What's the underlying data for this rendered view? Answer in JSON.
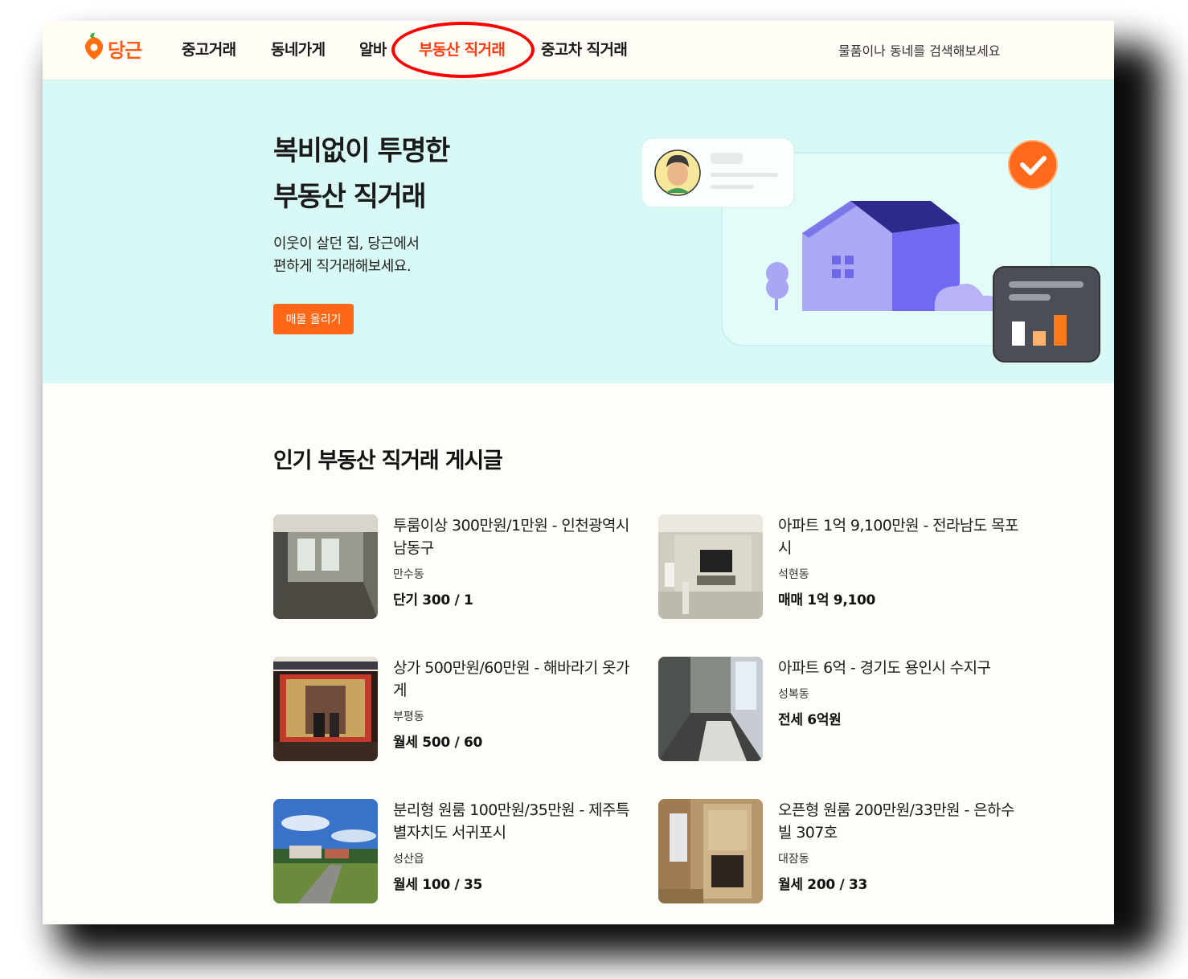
{
  "header": {
    "logo_text": "당근",
    "nav": [
      "중고거래",
      "동네가게",
      "알바",
      "부동산 직거래",
      "중고차 직거래"
    ],
    "active_index": 3,
    "search_placeholder": "물품이나 동네를 검색해보세요"
  },
  "hero": {
    "title_line1": "복비없이 투명한",
    "title_line2": "부동산 직거래",
    "desc_line1": "이웃이 살던 집, 당근에서",
    "desc_line2": "편하게 직거래해보세요.",
    "button_label": "매물 올리기"
  },
  "listings_section": {
    "title": "인기 부동산 직거래 게시글",
    "items": [
      {
        "title": "투룸이상 300만원/1만원 - 인천광역시 남동구",
        "location": "만수동",
        "price": "단기 300 / 1"
      },
      {
        "title": "아파트 1억 9,100만원 - 전라남도 목포시",
        "location": "석현동",
        "price": "매매 1억 9,100"
      },
      {
        "title": "상가 500만원/60만원 - 해바라기 옷가게",
        "location": "부평동",
        "price": "월세 500 / 60"
      },
      {
        "title": "아파트 6억 - 경기도 용인시 수지구",
        "location": "성복동",
        "price": "전세 6억원"
      },
      {
        "title": "분리형 원룸 100만원/35만원 - 제주특별자치도 서귀포시",
        "location": "성산읍",
        "price": "월세 100 / 35"
      },
      {
        "title": "오픈형 원룸 200만원/33만원 - 은하수빌 307호",
        "location": "대잠동",
        "price": "월세 200 / 33"
      }
    ]
  },
  "colors": {
    "brand": "#ff6817",
    "active_nav": "#ff3b10",
    "hero_bg": "#d9f9f6",
    "highlight_circle": "#ff0000"
  }
}
